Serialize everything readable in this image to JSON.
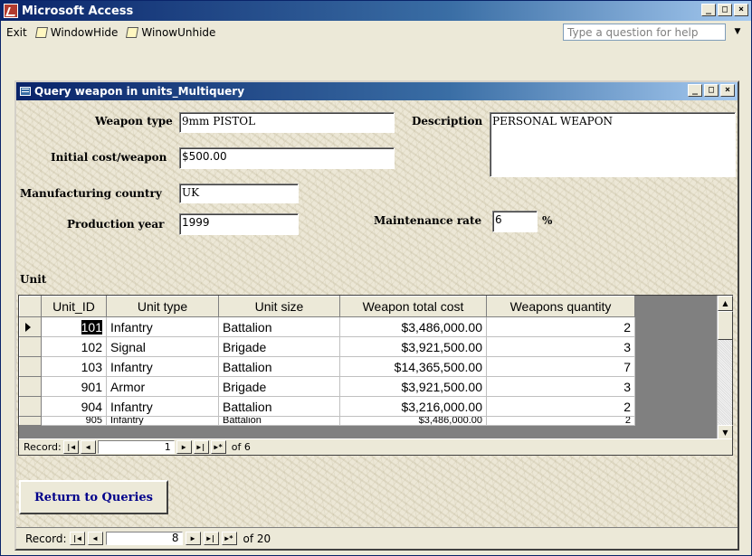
{
  "app": {
    "title": "Microsoft Access",
    "menu": [
      "Exit",
      "WindowHide",
      "WinowUnhide"
    ],
    "help_placeholder": "Type a question for help"
  },
  "form": {
    "title": "Query weapon in units_Multiquery",
    "labels": {
      "weapon_type": "Weapon type",
      "initial_cost": "Initial cost/weapon",
      "manufacturing_country": "Manufacturing country",
      "production_year": "Production year",
      "description": "Description",
      "maintenance_rate": "Maintenance rate",
      "percent": "%",
      "unit": "Unit"
    },
    "values": {
      "weapon_type": "9mm PISTOL",
      "initial_cost": "$500.00",
      "manufacturing_country": "UK",
      "production_year": "1999",
      "description": "PERSONAL WEAPON",
      "maintenance_rate": "6"
    },
    "subform": {
      "columns": [
        "Unit_ID",
        "Unit type",
        "Unit size",
        "Weapon total cost",
        "Weapons quantity"
      ],
      "rows": [
        [
          "101",
          "Infantry",
          "Battalion",
          "$3,486,000.00",
          "2"
        ],
        [
          "102",
          "Signal",
          "Brigade",
          "$3,921,500.00",
          "3"
        ],
        [
          "103",
          "Infantry",
          "Battalion",
          "$14,365,500.00",
          "7"
        ],
        [
          "901",
          "Armor",
          "Brigade",
          "$3,921,500.00",
          "3"
        ],
        [
          "904",
          "Infantry",
          "Battalion",
          "$3,216,000.00",
          "2"
        ],
        [
          "905",
          "Infantry",
          "Battalion",
          "$3,486,000.00",
          "2"
        ]
      ],
      "nav": {
        "label": "Record:",
        "current": "1",
        "of": "of 6"
      }
    },
    "return_button": "Return to Queries",
    "nav": {
      "label": "Record:",
      "current": "8",
      "of": "of 20"
    }
  }
}
